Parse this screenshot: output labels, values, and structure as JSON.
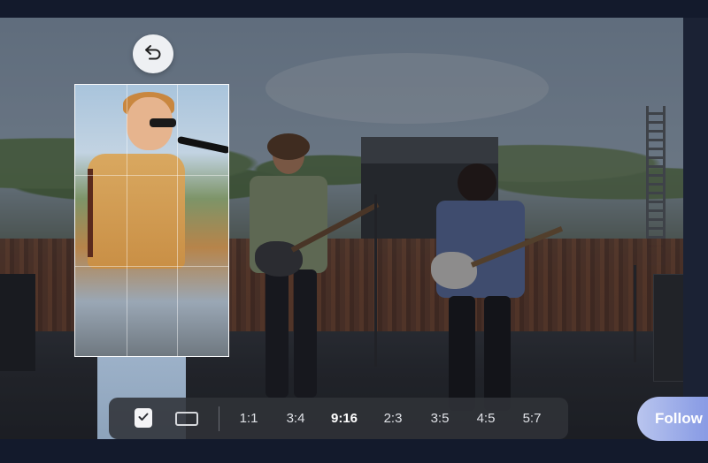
{
  "toolbar": {
    "ratios": [
      "1:1",
      "3:4",
      "9:16",
      "2:3",
      "3:5",
      "4:5",
      "5:7"
    ],
    "active_ratio": "9:16"
  },
  "follow_button": {
    "label": "Follow"
  },
  "icons": {
    "undo": "undo-icon",
    "confirm": "checkmark-icon",
    "freeform": "rectangle-icon"
  },
  "colors": {
    "follow_gradient_start": "#b9c5ee",
    "follow_gradient_end": "#7d8fe0",
    "toolbar_bg": "#303238"
  }
}
